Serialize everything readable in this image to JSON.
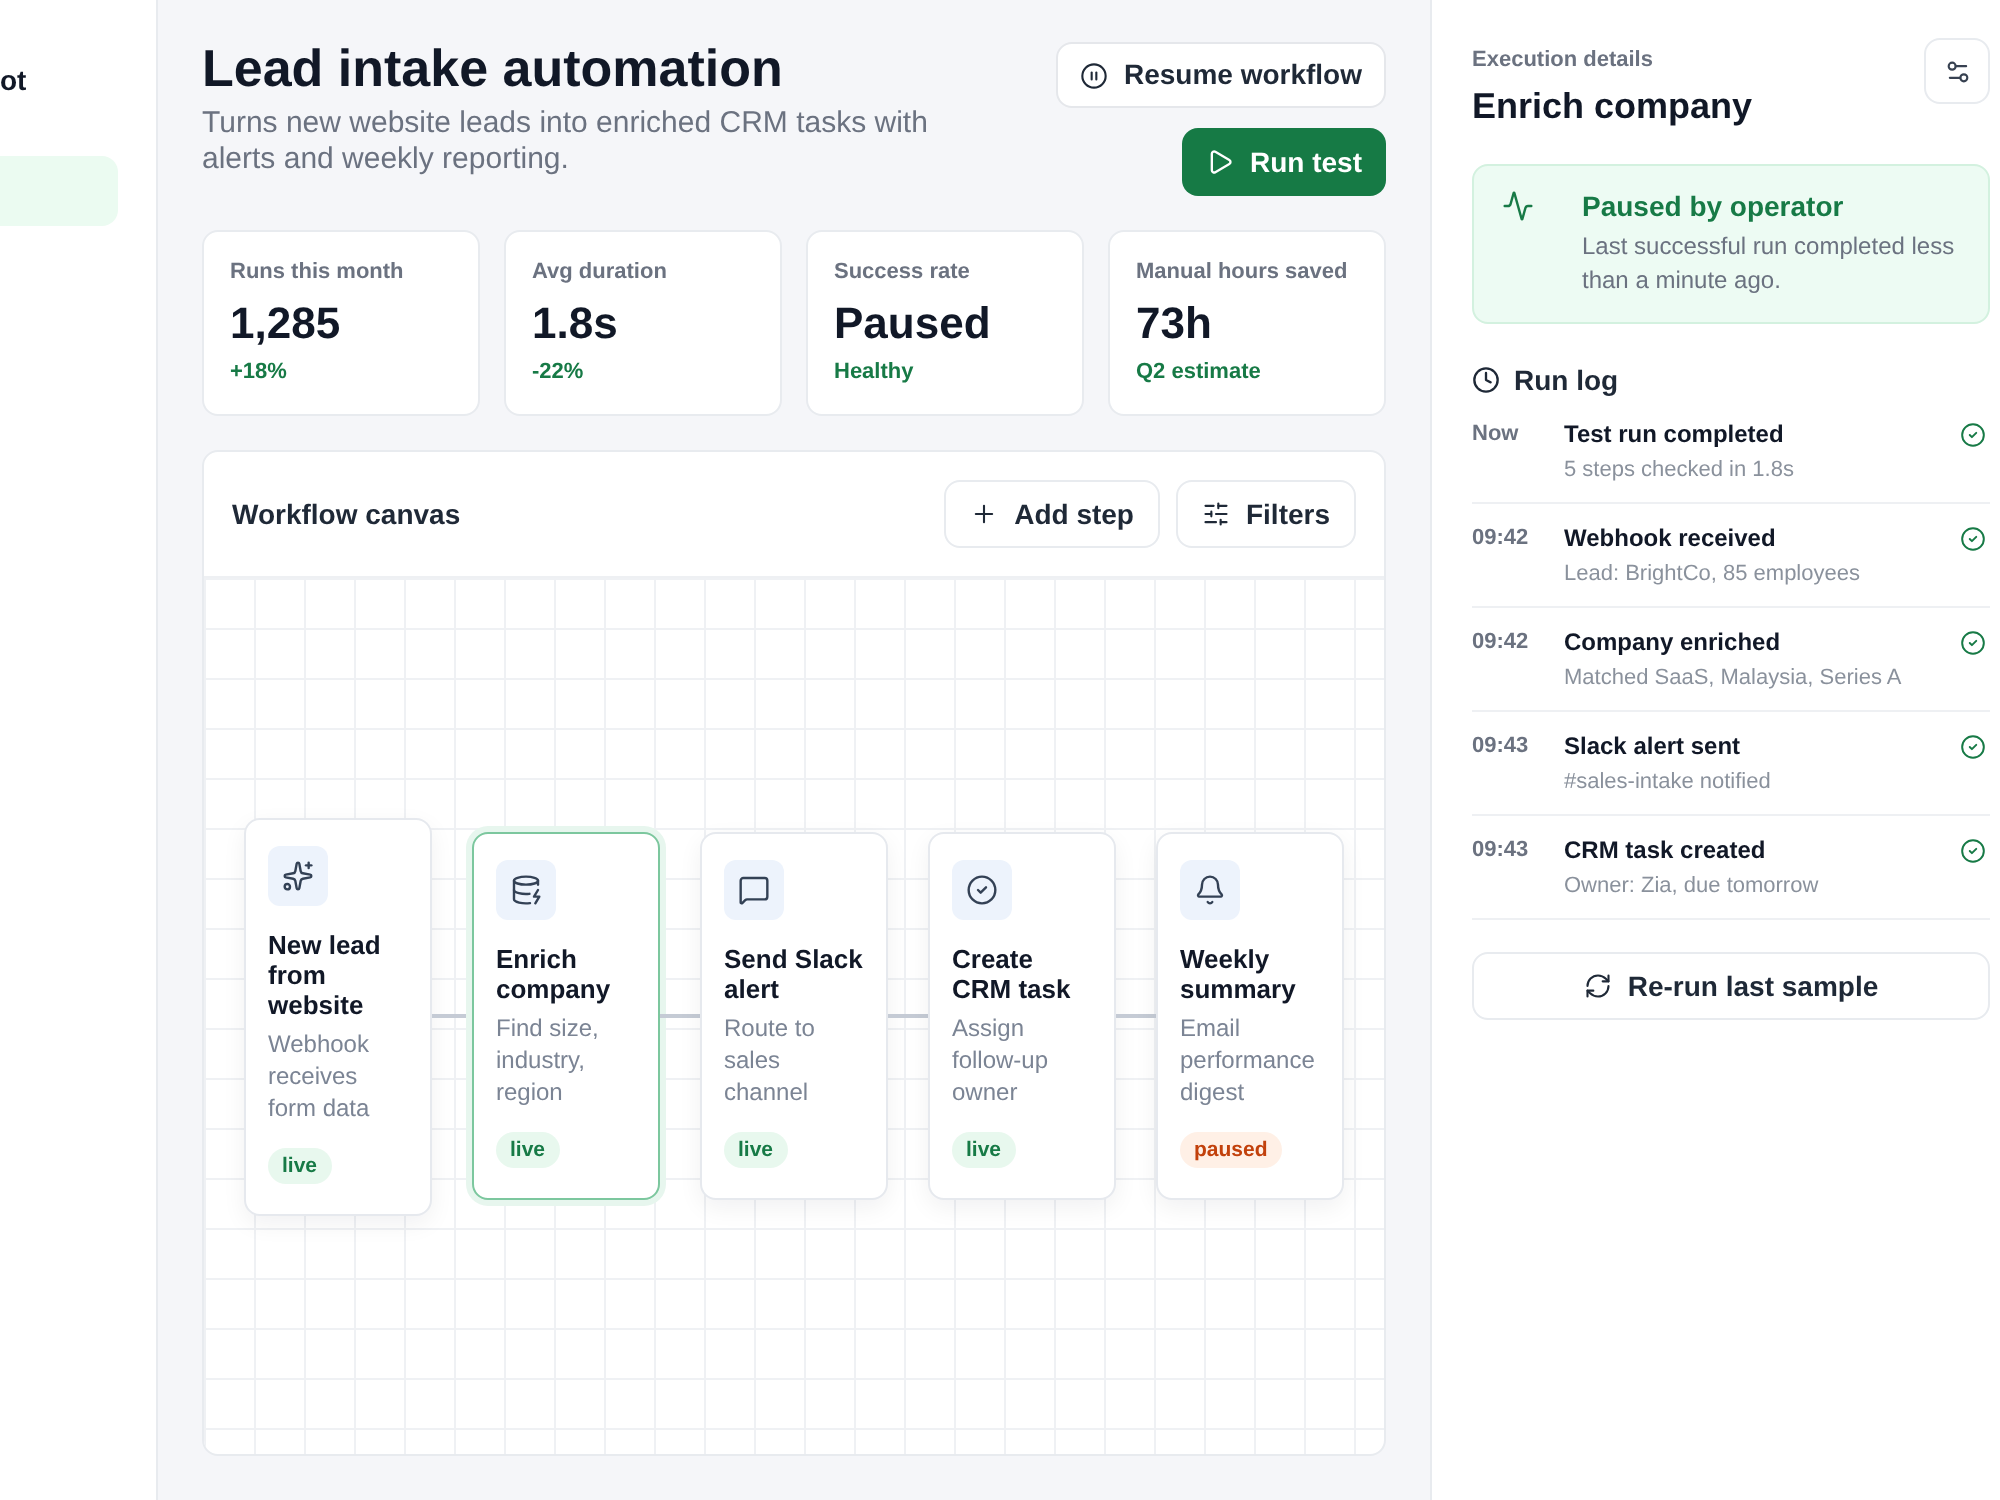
{
  "sidebar": {
    "brand": "ot",
    "items": [
      {
        "selected": true
      }
    ]
  },
  "header": {
    "title": "Lead intake automation",
    "subtitle": "Turns new website leads into enriched CRM tasks with alerts and weekly reporting.",
    "resume_button": "Resume workflow",
    "run_test_button": "Run test"
  },
  "stats": [
    {
      "label": "Runs this month",
      "value": "1,285",
      "note": "+18%"
    },
    {
      "label": "Avg duration",
      "value": "1.8s",
      "note": "-22%"
    },
    {
      "label": "Success rate",
      "value": "Paused",
      "note": "Healthy"
    },
    {
      "label": "Manual hours saved",
      "value": "73h",
      "note": "Q2 estimate"
    }
  ],
  "canvas": {
    "title": "Workflow canvas",
    "add_step_button": "Add step",
    "filters_button": "Filters",
    "nodes": [
      {
        "title": "New lead from website",
        "description": "Webhook receives form data",
        "status": {
          "label": "live",
          "kind": "live"
        },
        "selected": false
      },
      {
        "title": "Enrich company",
        "description": "Find size, industry, region",
        "status": {
          "label": "live",
          "kind": "live"
        },
        "selected": true
      },
      {
        "title": "Send Slack alert",
        "description": "Route to sales channel",
        "status": {
          "label": "live",
          "kind": "live"
        },
        "selected": false
      },
      {
        "title": "Create CRM task",
        "description": "Assign follow-up owner",
        "status": {
          "label": "live",
          "kind": "live"
        },
        "selected": false
      },
      {
        "title": "Weekly summary",
        "description": "Email performance digest",
        "status": {
          "label": "paused",
          "kind": "paused"
        },
        "selected": false
      }
    ]
  },
  "details": {
    "eyebrow": "Execution details",
    "title": "Enrich company",
    "alert": {
      "title": "Paused by operator",
      "message": "Last successful run completed less than a minute ago."
    },
    "run_log": {
      "title": "Run log",
      "entries": [
        {
          "time": "Now",
          "title": "Test run completed",
          "detail": "5 steps checked in 1.8s"
        },
        {
          "time": "09:42",
          "title": "Webhook received",
          "detail": "Lead: BrightCo, 85 employees"
        },
        {
          "time": "09:42",
          "title": "Company enriched",
          "detail": "Matched SaaS, Malaysia, Series A"
        },
        {
          "time": "09:43",
          "title": "Slack alert sent",
          "detail": "#sales-intake notified"
        },
        {
          "time": "09:43",
          "title": "CRM task created",
          "detail": "Owner: Zia, due tomorrow"
        }
      ]
    },
    "rerun_button": "Re-run last sample"
  }
}
